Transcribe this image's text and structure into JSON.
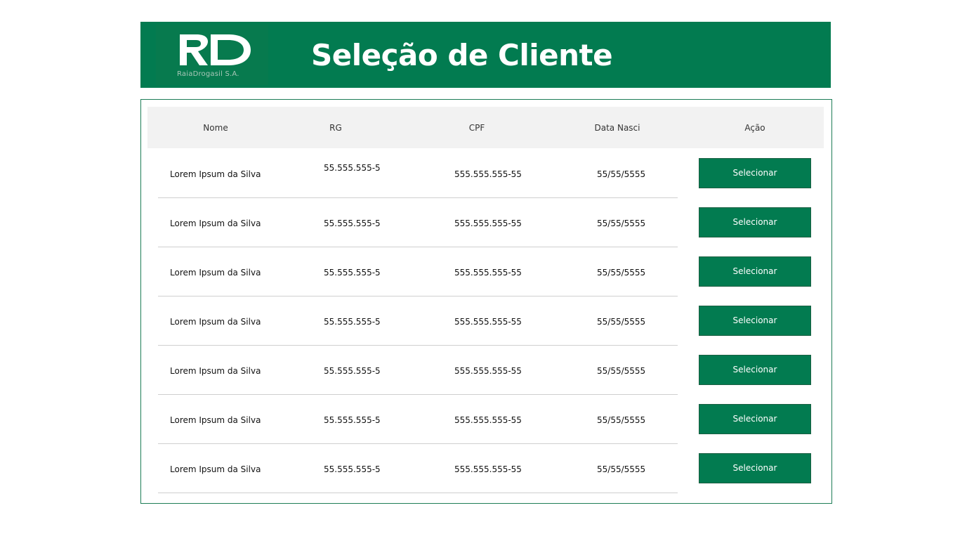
{
  "header": {
    "title": "Seleção de Cliente",
    "logo_caption": "RaiaDrogasil S.A.",
    "brand_color": "#027b50"
  },
  "table": {
    "columns": [
      "Nome",
      "RG",
      "CPF",
      "Data Nasci",
      "Ação"
    ],
    "rows": [
      {
        "nome": "Lorem Ipsum da Silva",
        "rg": "55.555.555-5",
        "cpf": "555.555.555-55",
        "data": "55/55/5555",
        "acao": "Selecionar"
      },
      {
        "nome": "Lorem Ipsum da Silva",
        "rg": "55.555.555-5",
        "cpf": "555.555.555-55",
        "data": "55/55/5555",
        "acao": "Selecionar"
      },
      {
        "nome": "Lorem Ipsum da Silva",
        "rg": "55.555.555-5",
        "cpf": "555.555.555-55",
        "data": "55/55/5555",
        "acao": "Selecionar"
      },
      {
        "nome": "Lorem Ipsum da Silva",
        "rg": "55.555.555-5",
        "cpf": "555.555.555-55",
        "data": "55/55/5555",
        "acao": "Selecionar"
      },
      {
        "nome": "Lorem Ipsum da Silva",
        "rg": "55.555.555-5",
        "cpf": "555.555.555-55",
        "data": "55/55/5555",
        "acao": "Selecionar"
      },
      {
        "nome": "Lorem Ipsum da Silva",
        "rg": "55.555.555-5",
        "cpf": "555.555.555-55",
        "data": "55/55/5555",
        "acao": "Selecionar"
      },
      {
        "nome": "Lorem Ipsum da Silva",
        "rg": "55.555.555-5",
        "cpf": "555.555.555-55",
        "data": "55/55/5555",
        "acao": "Selecionar"
      }
    ]
  }
}
